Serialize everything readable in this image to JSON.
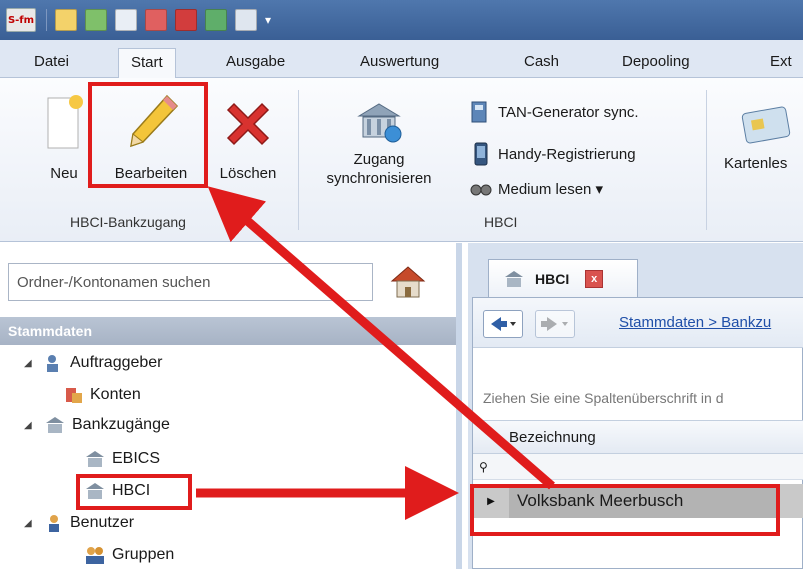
{
  "quick_access": {
    "logo_text": "S-fm",
    "dropdown_glyph": "▾"
  },
  "ribbon_tabs": [
    {
      "label": "Datei"
    },
    {
      "label": "Start"
    },
    {
      "label": "Ausgabe"
    },
    {
      "label": "Auswertung"
    },
    {
      "label": "Cash"
    },
    {
      "label": "Depooling"
    },
    {
      "label": "Ext"
    }
  ],
  "ribbon": {
    "new_label": "Neu",
    "edit_label": "Bearbeiten",
    "delete_label": "Löschen",
    "group_bank_access": "HBCI-Bankzugang",
    "sync_label_line1": "Zugang",
    "sync_label_line2": "synchronisieren",
    "tan_sync_label": "TAN-Generator sync.",
    "mobile_reg_label": "Handy-Registrierung",
    "medium_read_label": "Medium lesen ▾",
    "group_hbci": "HBCI",
    "card_reader_label": "Kartenles"
  },
  "navigation": {
    "search_placeholder": "Ordner-/Kontonamen suchen",
    "section_header": "Stammdaten",
    "tree": [
      {
        "label": "Auftraggeber",
        "expander": "◢"
      },
      {
        "label": "Konten"
      },
      {
        "label": "Bankzugänge",
        "expander": "◢"
      },
      {
        "label": "EBICS"
      },
      {
        "label": "HBCI"
      },
      {
        "label": "Benutzer",
        "expander": "◢"
      },
      {
        "label": "Gruppen"
      }
    ]
  },
  "document": {
    "tab_label": "HBCI",
    "close_glyph": "x",
    "breadcrumb": "Stammdaten > Bankzu",
    "group_hint": "Ziehen Sie eine Spaltenüberschrift in d",
    "column_header": "Bezeichnung",
    "rows": [
      {
        "bezeichnung": "Volksbank Meerbusch"
      }
    ]
  },
  "colors": {
    "highlight": "#e01c1c",
    "title_bar": "#4f77ad",
    "section_header": "#b0bccd"
  }
}
